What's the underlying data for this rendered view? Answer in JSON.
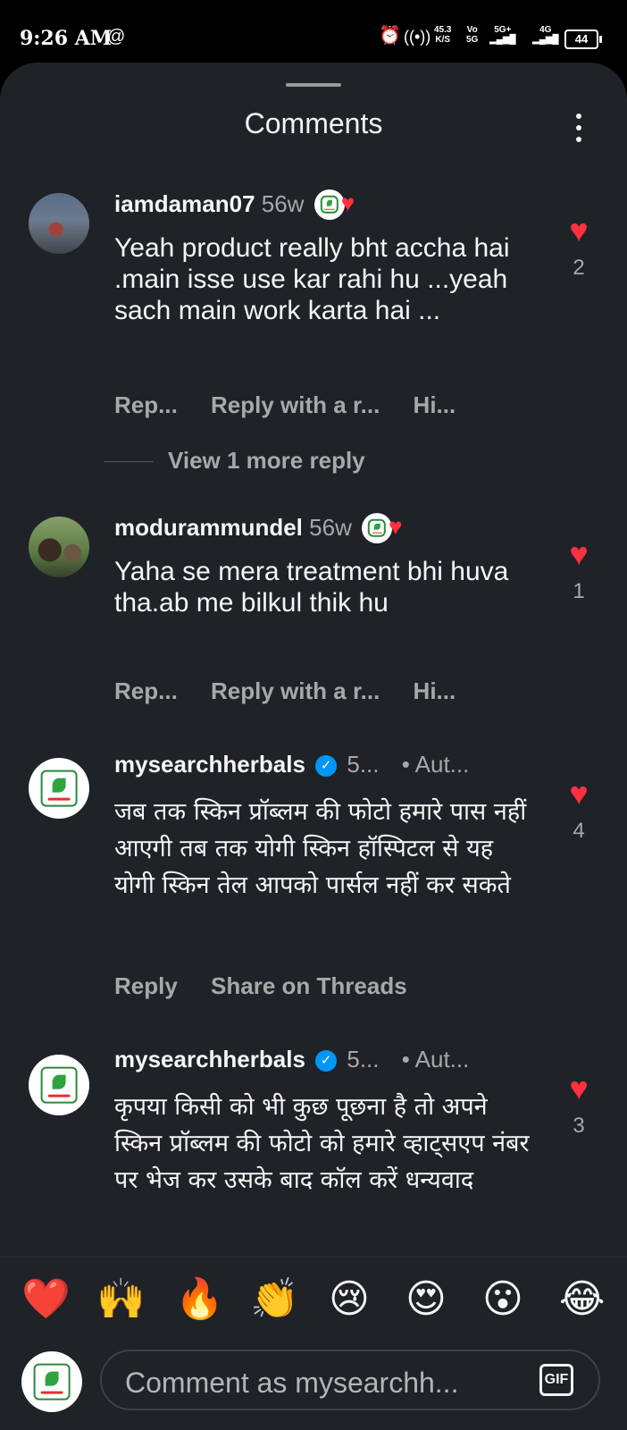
{
  "status_bar": {
    "time": "9:26 AM",
    "net_speed_value": "45.3",
    "net_speed_unit": "K/S",
    "volte_top": "Vo",
    "volte_bottom": "5G",
    "signal1_label": "5G+",
    "signal2_label": "4G",
    "battery": "44"
  },
  "sheet": {
    "title": "Comments"
  },
  "comments": [
    {
      "username": "iamdaman07",
      "time": "56w",
      "text": "Yeah product really bht accha hai .main isse use kar rahi hu ...yeah sach main work karta hai ...",
      "actions": [
        "Rep...",
        "Reply with a r...",
        "Hi..."
      ],
      "likes": "2",
      "view_replies": "View 1 more reply"
    },
    {
      "username": "modurammundel",
      "time": "56w",
      "text": "Yaha se mera treatment bhi huva tha.ab me bilkul thik hu",
      "actions": [
        "Rep...",
        "Reply with a r...",
        "Hi..."
      ],
      "likes": "1"
    },
    {
      "username": "mysearchherbals",
      "time": "5...",
      "badge": "• Aut...",
      "text": "जब तक स्किन प्रॉब्लम की फोटो हमारे पास नहीं आएगी तब तक योगी स्किन हॉस्पिटल से यह योगी स्किन तेल आपको पार्सल नहीं कर सकते",
      "actions": [
        "Reply",
        "Share on Threads"
      ],
      "likes": "4"
    },
    {
      "username": "mysearchherbals",
      "time": "5...",
      "badge": "• Aut...",
      "text": "कृपया किसी को भी कुछ पूछना है तो अपने स्किन प्रॉब्लम की फोटो को हमारे व्हाट्सएप नंबर पर भेज कर उसके बाद कॉल करें धन्यवाद",
      "likes": "3"
    }
  ],
  "emoji_bar": [
    "❤️",
    "🙌",
    "🔥",
    "👏",
    "😢",
    "😍",
    "😮",
    "😂"
  ],
  "composer": {
    "placeholder": "Comment as mysearchh...",
    "gif_label": "GIF"
  },
  "icons": {
    "heart": "heart-icon",
    "verified": "verified-badge-icon",
    "more": "kebab-menu-icon",
    "gif": "gif-icon"
  },
  "colors": {
    "like_red": "#ff3040",
    "verified_blue": "#0095f6",
    "sheet_bg": "#1f2227"
  }
}
